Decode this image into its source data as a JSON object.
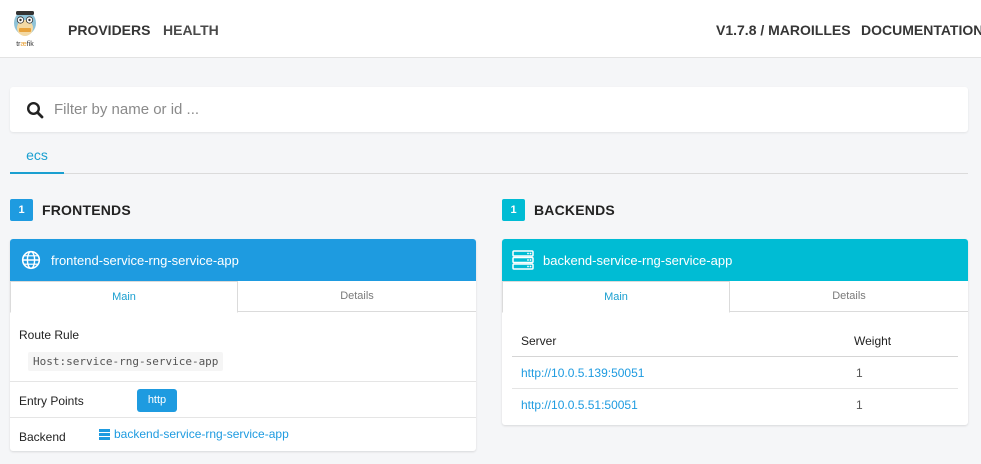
{
  "navbar": {
    "logo_alt": "traefik",
    "links": [
      {
        "label": "PROVIDERS"
      },
      {
        "label": "HEALTH"
      }
    ],
    "version": "V1.7.8 / MAROILLES",
    "documentation": "DOCUMENTATION"
  },
  "search": {
    "placeholder": "Filter by name or id ..."
  },
  "providers": {
    "tabs": [
      {
        "label": "ecs",
        "active": true
      }
    ]
  },
  "colors": {
    "frontend_accent": "#1e9be0",
    "backend_accent": "#00bcd4",
    "link": "#1e9be0"
  },
  "frontends": {
    "count": "1",
    "title": "FRONTENDS",
    "card": {
      "icon": "globe-icon",
      "name": "frontend-service-rng-service-app",
      "tabs": [
        "Main",
        "Details"
      ],
      "route_rule_label": "Route Rule",
      "route_rule_value": "Host:service-rng-service-app",
      "entry_points_label": "Entry Points",
      "entry_points": [
        "http"
      ],
      "backend_label": "Backend",
      "backend_value": "backend-service-rng-service-app"
    }
  },
  "backends": {
    "count": "1",
    "title": "BACKENDS",
    "card": {
      "icon": "server-icon",
      "name": "backend-service-rng-service-app",
      "tabs": [
        "Main",
        "Details"
      ],
      "columns": [
        "Server",
        "Weight"
      ],
      "servers": [
        {
          "url": "http://10.0.5.139:50051",
          "weight": "1"
        },
        {
          "url": "http://10.0.5.51:50051",
          "weight": "1"
        }
      ]
    }
  }
}
